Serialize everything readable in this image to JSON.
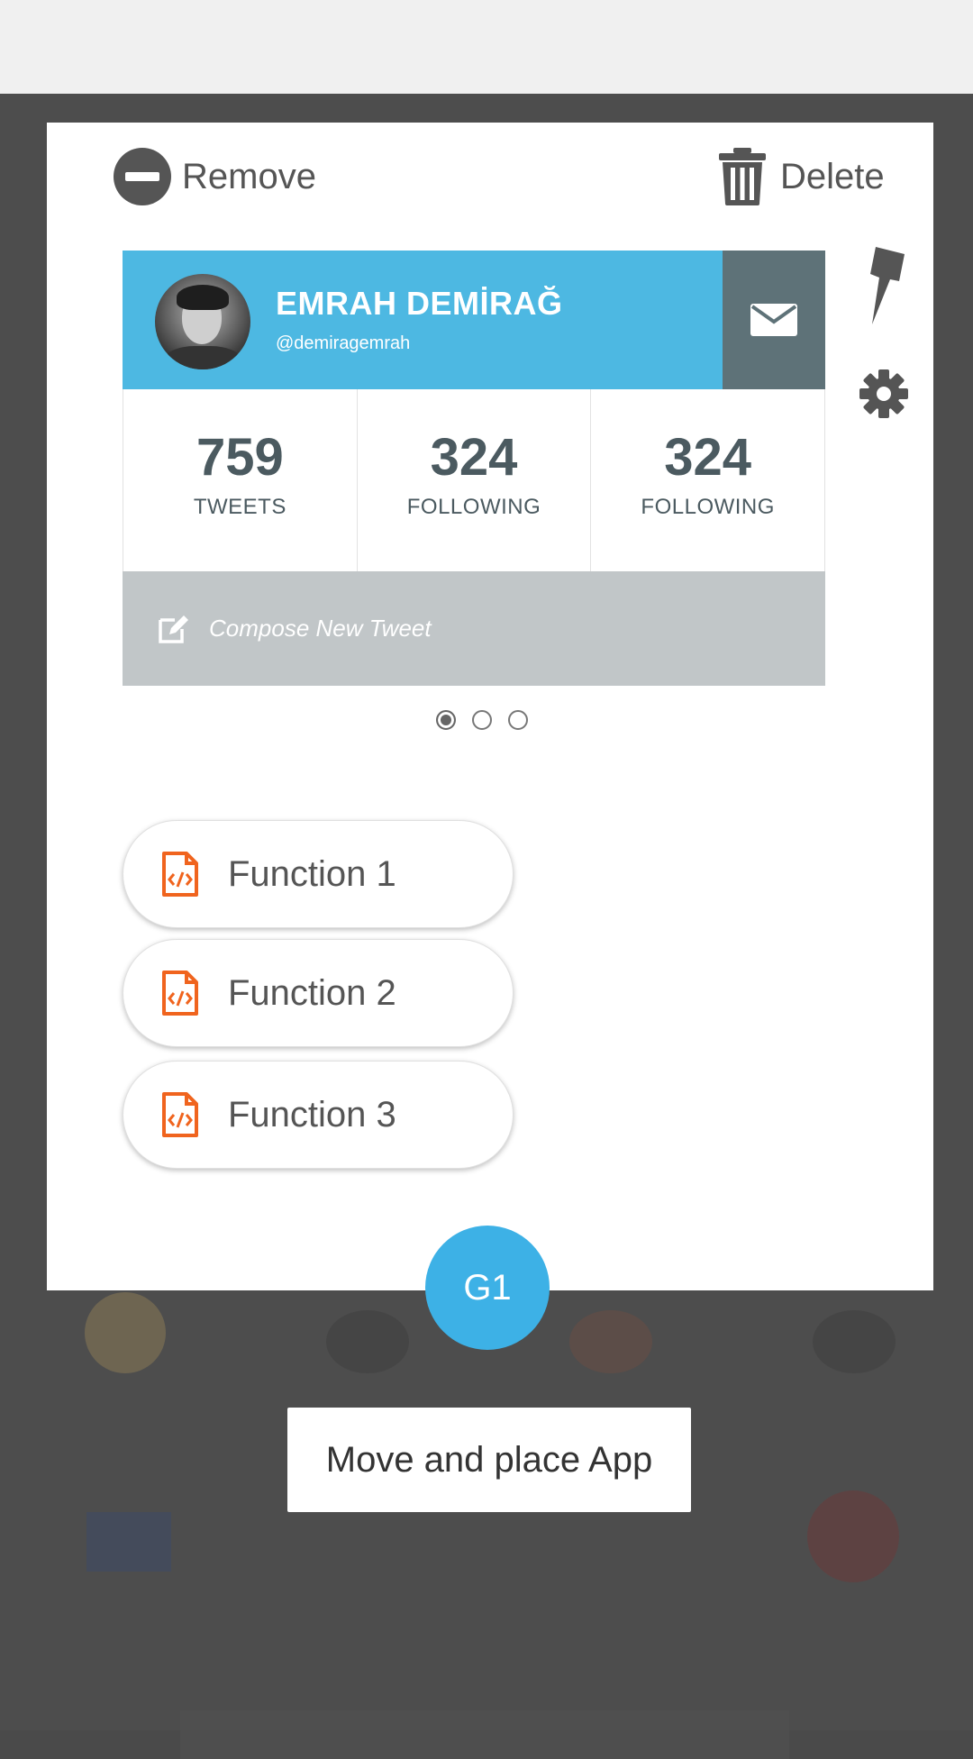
{
  "header": {
    "remove_label": "Remove",
    "delete_label": "Delete"
  },
  "profile_card": {
    "name": "EMRAH DEMİRAĞ",
    "handle": "@demiragemrah",
    "stats": [
      {
        "value": "759",
        "label": "TWEETS"
      },
      {
        "value": "324",
        "label": "FOLLOWING"
      },
      {
        "value": "324",
        "label": "FOLLOWING"
      }
    ],
    "compose_text": "Compose New Tweet",
    "header_color": "#4db8e2"
  },
  "pagination": {
    "total": 3,
    "active": 1
  },
  "functions": [
    {
      "label": "Function 1"
    },
    {
      "label": "Function 2"
    },
    {
      "label": "Function 3"
    }
  ],
  "group_button": {
    "label": "G1",
    "color": "#3db1e6"
  },
  "tooltip": {
    "text": "Move and place App"
  },
  "icons": {
    "remove": "minus-circle-icon",
    "delete": "trash-icon",
    "pin": "pin-icon",
    "settings": "gear-icon",
    "mail": "mail-icon",
    "compose": "edit-icon",
    "function": "code-file-icon"
  }
}
